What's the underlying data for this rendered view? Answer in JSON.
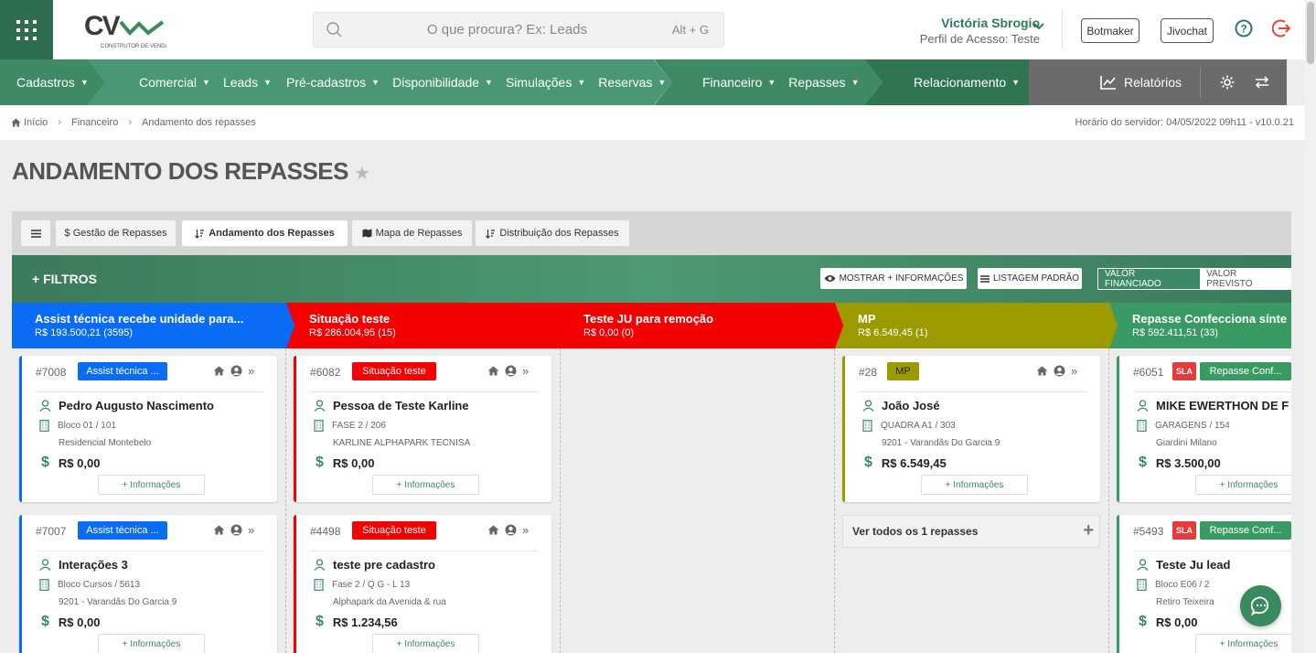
{
  "topbar": {
    "logo_text": "CV",
    "logo_sub": "CONSTRUTOR DE VENDAS",
    "search_placeholder": "O que procura? Ex: Leads",
    "search_shortcut": "Alt + G",
    "user_name": "Victória Sbrogio",
    "user_profile": "Perfil de Acesso: Teste",
    "botmaker_label": "Botmaker",
    "jivochat_label": "Jivochat"
  },
  "nav": {
    "cadastros": "Cadastros",
    "comercial": "Comercial",
    "leads": "Leads",
    "precadastros": "Pré-cadastros",
    "disponibilidade": "Disponibilidade",
    "simulacoes": "Simulações",
    "reservas": "Reservas",
    "financeiro": "Financeiro",
    "repasses": "Repasses",
    "relacionamento": "Relacionamento",
    "relatorios": "Relatórios"
  },
  "breadcrumb": {
    "items": [
      "Início",
      "Financeiro",
      "Andamento dos repasses"
    ],
    "server_time": "Horário do servidor: 04/05/2022 09h11 - v10.0.21"
  },
  "page_title": "ANDAMENTO DOS REPASSES",
  "tabs": [
    {
      "label": "$ Gestão de Repasses"
    },
    {
      "label": "Andamento dos Repasses"
    },
    {
      "label": "Mapa de Repasses"
    },
    {
      "label": "Distribuição dos Repasses"
    }
  ],
  "filters": {
    "label": "+ FILTROS",
    "show_more": "MOSTRAR + INFORMAÇÕES",
    "list_default": "LISTAGEM PADRÃO",
    "valor_financiado": "VALOR FINANCIADO",
    "valor_previsto": "VALOR PREVISTO"
  },
  "columns": [
    {
      "title": "Assist técnica recebe unidade para...",
      "value": "R$ 193.500,21 (3595)",
      "color": "#0a6cf5"
    },
    {
      "title": "Situação teste",
      "value": "R$ 286.004,95 (15)",
      "color": "#f50000"
    },
    {
      "title": "Teste JU para remoção",
      "value": "R$ 0,00 (0)",
      "color": "#f50000"
    },
    {
      "title": "MP",
      "value": "R$ 6.549,45 (1)",
      "color": "#9b9b00"
    },
    {
      "title": "Repasse Confecciona sínte",
      "value": "R$ 592.411,51 (33)",
      "color": "#3a9a64"
    }
  ],
  "cards": {
    "c1": {
      "id": "#7008",
      "badge": "Assist técnica ...",
      "name": "Pedro Augusto Nascimento",
      "unit": "Bloco 01 / 101",
      "project": "Residencial Montebelo",
      "value": "R$ 0,00",
      "info": "+ Informações"
    },
    "c2": {
      "id": "#7007",
      "badge": "Assist técnica ...",
      "name": "Interações 3",
      "unit": "Bloco Cursos / 5613",
      "project": "9201 - Varandãs Do Garcia 9",
      "value": "R$ 0,00",
      "info": "+ Informações"
    },
    "c3": {
      "id": "#6082",
      "badge": "Situação teste",
      "name": "Pessoa de Teste Karline",
      "unit": "FASE 2 / 206",
      "project": "KARLINE ALPHAPARK TECNISA",
      "value": "R$ 0,00",
      "info": "+ Informações"
    },
    "c4": {
      "id": "#4498",
      "badge": "Situação teste",
      "name": "teste pre cadastro",
      "unit": "Fase 2 / Q G - L 13",
      "project": "Alphapark da Avenida & rua",
      "value": "R$ 1.234,56",
      "info": "+ Informações"
    },
    "c5": {
      "id": "#28",
      "badge": "MP",
      "name": "João José",
      "unit": "QUADRA A1 / 303",
      "project": "9201 - Varandãs Do Garcia 9",
      "value": "R$ 6.549,45",
      "info": "+ Informações"
    },
    "c6": {
      "id": "#6051",
      "sla": "SLA",
      "badge": "Repasse Conf...",
      "name": "MIKE EWERTHON DE F",
      "unit": "GARAGENS / 154",
      "project": "Giardini Milano",
      "value": "R$ 3.500,00",
      "info": "+ Informações"
    },
    "c7": {
      "id": "#5493",
      "sla": "SLA",
      "badge": "Repasse Conf...",
      "name": "Teste Ju lead",
      "unit": "Bloco E06 / 2",
      "project": "Retiro Teixeira",
      "value": "R$ 0,00",
      "info": "+ Informações"
    }
  },
  "see_all": "Ver todos os 1 repasses"
}
